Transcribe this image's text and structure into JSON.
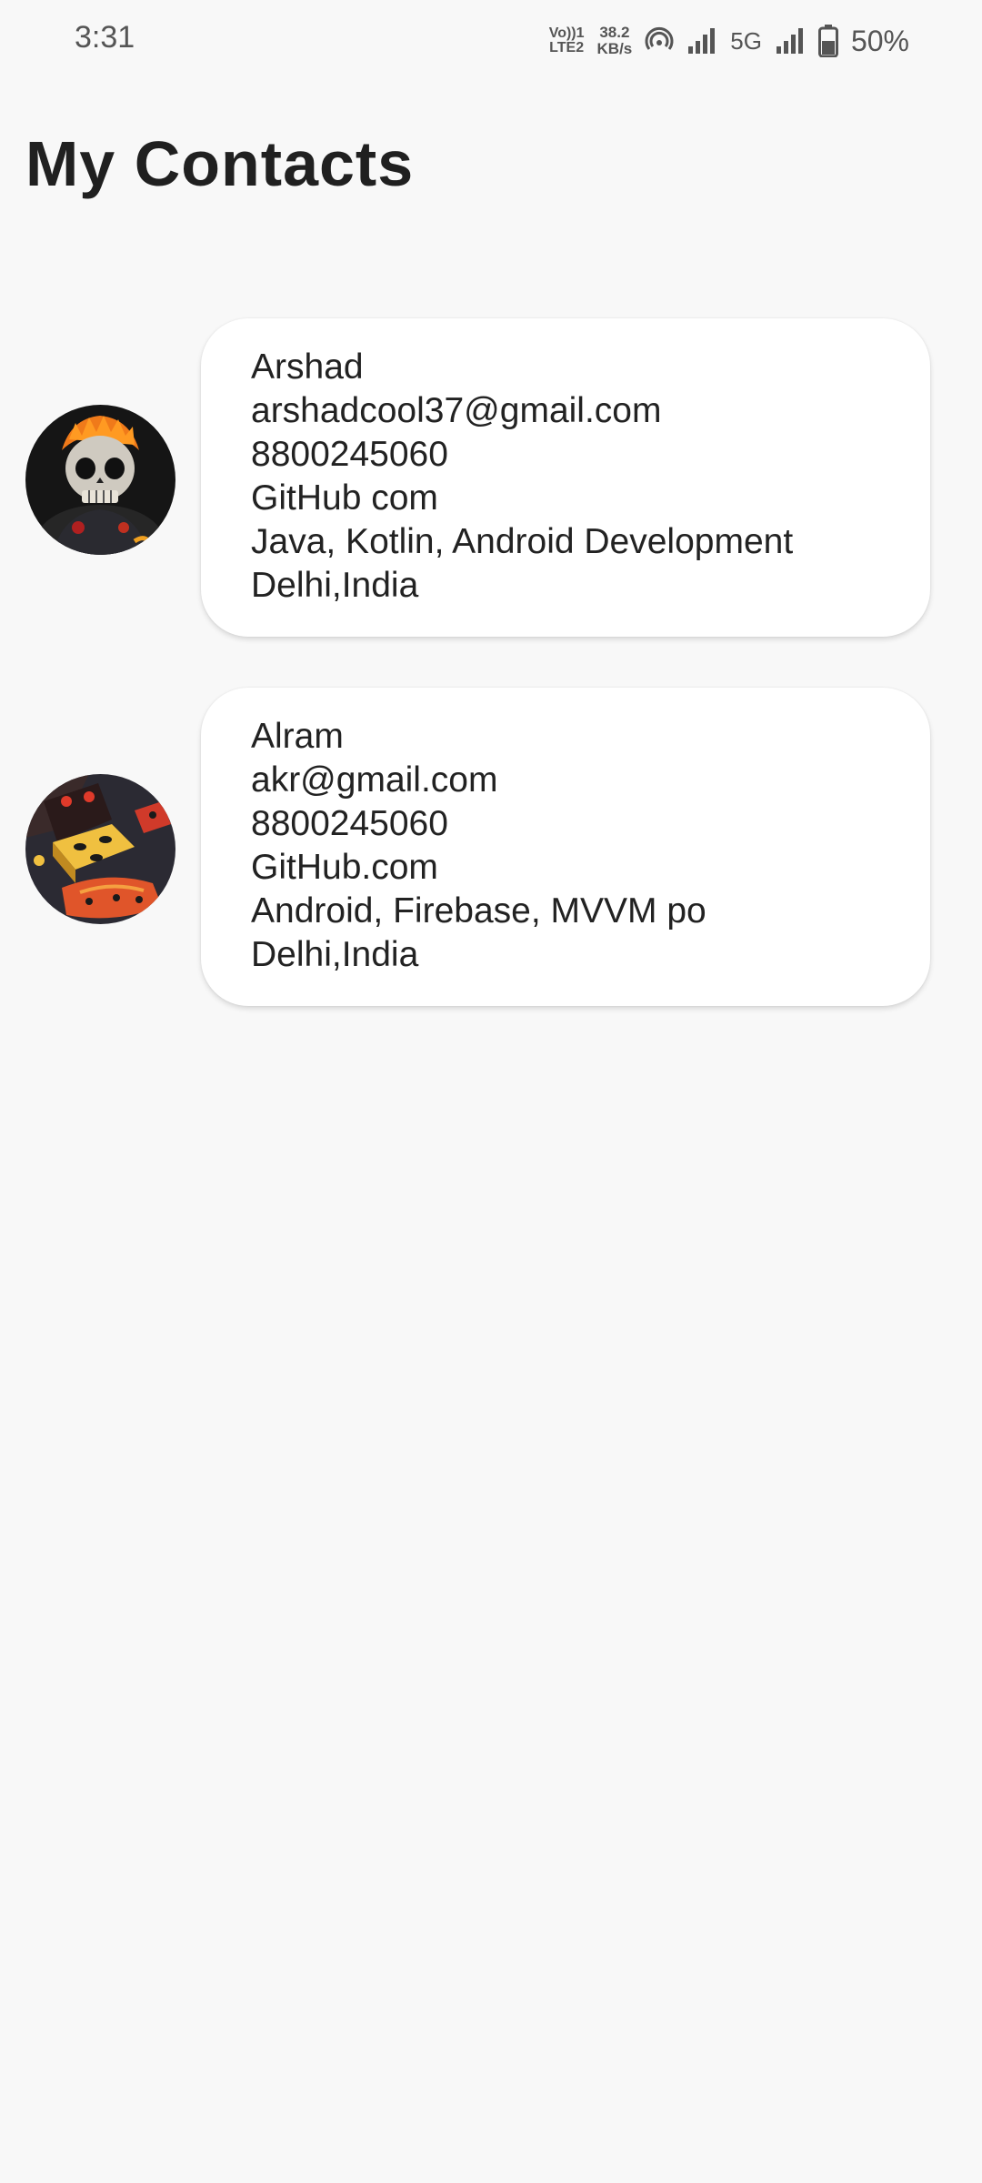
{
  "status_bar": {
    "time": "3:31",
    "volte_line1": "Vo))1",
    "volte_line2": "LTE2",
    "speed_value": "38.2",
    "speed_unit": "KB/s",
    "network_type": "5G",
    "battery": "50%",
    "icons": [
      "hotspot-icon",
      "signal-icon",
      "battery-icon"
    ]
  },
  "header": {
    "title": "My Contacts"
  },
  "contacts": [
    {
      "avatar": "skull-avatar",
      "name": "Arshad",
      "email": "arshadcool37@gmail.com",
      "phone": "8800245060",
      "github": "GitHub com",
      "skills": "Java, Kotlin, Android Development",
      "location": "Delhi,India"
    },
    {
      "avatar": "dice-avatar",
      "name": "Alram",
      "email": "akr@gmail.com",
      "phone": "8800245060",
      "github": "GitHub.com",
      "skills": "Android, Firebase, MVVM po",
      "location": "Delhi,India"
    }
  ],
  "colors": {
    "background": "#f8f8f8",
    "card": "#ffffff",
    "text": "#222222",
    "status_text": "#555555"
  }
}
